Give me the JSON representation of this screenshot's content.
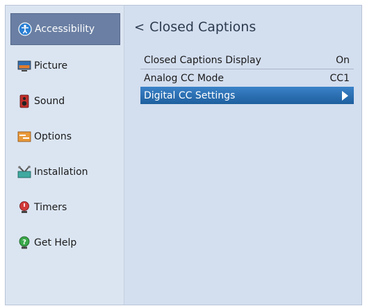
{
  "sidebar": {
    "items": [
      {
        "label": "Accessibility",
        "icon": "accessibility-icon",
        "active": true
      },
      {
        "label": "Picture",
        "icon": "picture-icon"
      },
      {
        "label": "Sound",
        "icon": "sound-icon"
      },
      {
        "label": "Options",
        "icon": "options-icon"
      },
      {
        "label": "Installation",
        "icon": "installation-icon"
      },
      {
        "label": "Timers",
        "icon": "timers-icon"
      },
      {
        "label": "Get Help",
        "icon": "help-icon"
      }
    ]
  },
  "page": {
    "back_glyph": "<",
    "title": "Closed Captions"
  },
  "settings": [
    {
      "label": "Closed Captions Display",
      "value": "On"
    },
    {
      "label": "Analog CC Mode",
      "value": "CC1"
    },
    {
      "label": "Digital CC Settings",
      "value": "",
      "selected": true,
      "icon": "arrow-right-icon"
    }
  ],
  "colors": {
    "panel": "#d3deef",
    "sidebar": "#dbe5f2",
    "active_nav": "#6a7fa3",
    "selected_row": "#2e71b6"
  }
}
